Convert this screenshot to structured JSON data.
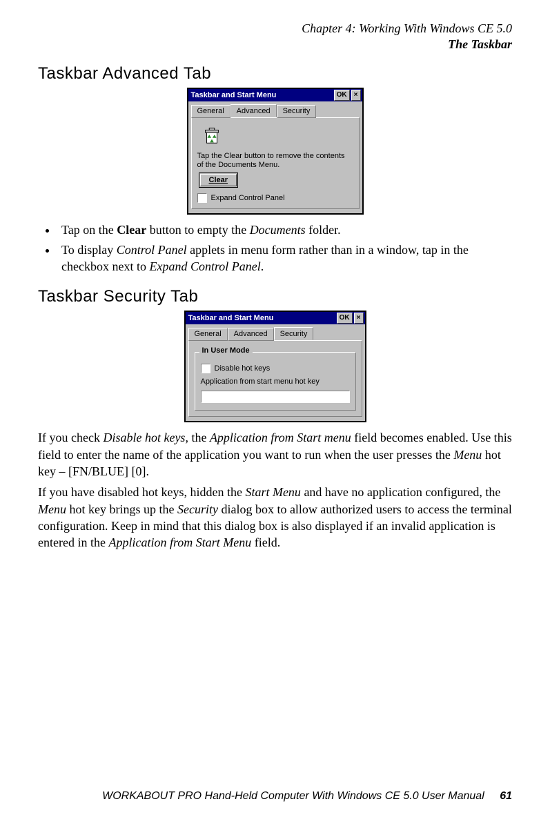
{
  "header": {
    "chapter_line": "Chapter 4: Working With Windows CE 5.0",
    "section_line": "The Taskbar"
  },
  "sections": {
    "advanced_heading": "Taskbar Advanced Tab",
    "security_heading": "Taskbar Security Tab"
  },
  "dialog_advanced": {
    "title": "Taskbar and Start Menu",
    "ok_label": "OK",
    "close_label": "×",
    "tabs": {
      "general": "General",
      "advanced": "Advanced",
      "security": "Security"
    },
    "hint": "Tap the Clear button to remove the contents of the Documents Menu.",
    "clear_label": "Clear",
    "expand_label": "Expand Control Panel"
  },
  "bullets": {
    "b1_pre": "Tap on the ",
    "b1_bold": "Clear",
    "b1_mid": " button to empty the ",
    "b1_ital": "Documents",
    "b1_post": " folder.",
    "b2_pre": "To display ",
    "b2_ital1": "Control Panel",
    "b2_mid": " applets in menu form rather than in a window, tap in the checkbox next to ",
    "b2_ital2": "Expand Control Panel",
    "b2_post": "."
  },
  "dialog_security": {
    "title": "Taskbar and Start Menu",
    "ok_label": "OK",
    "close_label": "×",
    "tabs": {
      "general": "General",
      "advanced": "Advanced",
      "security": "Security"
    },
    "group_legend": "In User Mode",
    "disable_label": "Disable hot keys",
    "app_label": "Application from start menu hot key",
    "app_value": ""
  },
  "paras": {
    "p1_a": "If you check ",
    "p1_i1": "Disable hot keys",
    "p1_b": ", the ",
    "p1_i2": "Application from Start menu",
    "p1_c": " field becomes enabled. Use this field to enter the name of the application you want to run when the user presses the ",
    "p1_i3": "Menu",
    "p1_d": " hot key – [FN/BLUE] [0].",
    "p2_a": "If you have disabled hot keys, hidden the ",
    "p2_i1": "Start Menu",
    "p2_b": " and have no application configured, the ",
    "p2_i2": "Menu",
    "p2_c": " hot key brings up the ",
    "p2_i3": "Security",
    "p2_d": " dialog box to allow authorized users to access the terminal configuration. Keep in mind that this dialog box is also displayed if an invalid application is entered in the ",
    "p2_i4": "Application from Start Menu",
    "p2_e": " field."
  },
  "footer": {
    "text": "WORKABOUT PRO Hand-Held Computer With Windows CE 5.0 User Manual",
    "page_number": "61"
  }
}
